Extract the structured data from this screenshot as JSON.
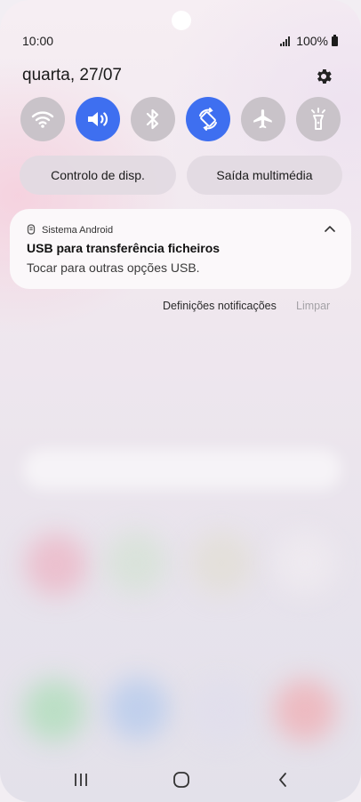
{
  "status_bar": {
    "time": "10:00",
    "battery_text": "100%",
    "icons": [
      "signal-icon",
      "battery-icon"
    ]
  },
  "quick_panel": {
    "date": "quarta, 27/07",
    "settings_icon": "gear-icon",
    "tiles": [
      {
        "name": "wifi",
        "icon": "wifi-icon",
        "active": false
      },
      {
        "name": "sound",
        "icon": "volume-icon",
        "active": true
      },
      {
        "name": "bluetooth",
        "icon": "bluetooth-icon",
        "active": false
      },
      {
        "name": "auto-rotate",
        "icon": "rotate-icon",
        "active": true
      },
      {
        "name": "airplane-mode",
        "icon": "airplane-icon",
        "active": false
      },
      {
        "name": "flashlight",
        "icon": "flashlight-icon",
        "active": false
      }
    ],
    "device_control_label": "Controlo de disp.",
    "media_output_label": "Saída multimédia",
    "active_color": "#3e6ff0"
  },
  "notification": {
    "app_name": "Sistema Android",
    "title": "USB para transferência ficheiros",
    "text": "Tocar para outras opções USB.",
    "app_icon": "usb-icon",
    "expand_icon": "chevron-up-icon"
  },
  "notification_actions": {
    "settings_label": "Definições notificações",
    "clear_label": "Limpar"
  },
  "nav_bar": {
    "buttons": [
      "recents-icon",
      "home-icon",
      "back-icon"
    ]
  }
}
